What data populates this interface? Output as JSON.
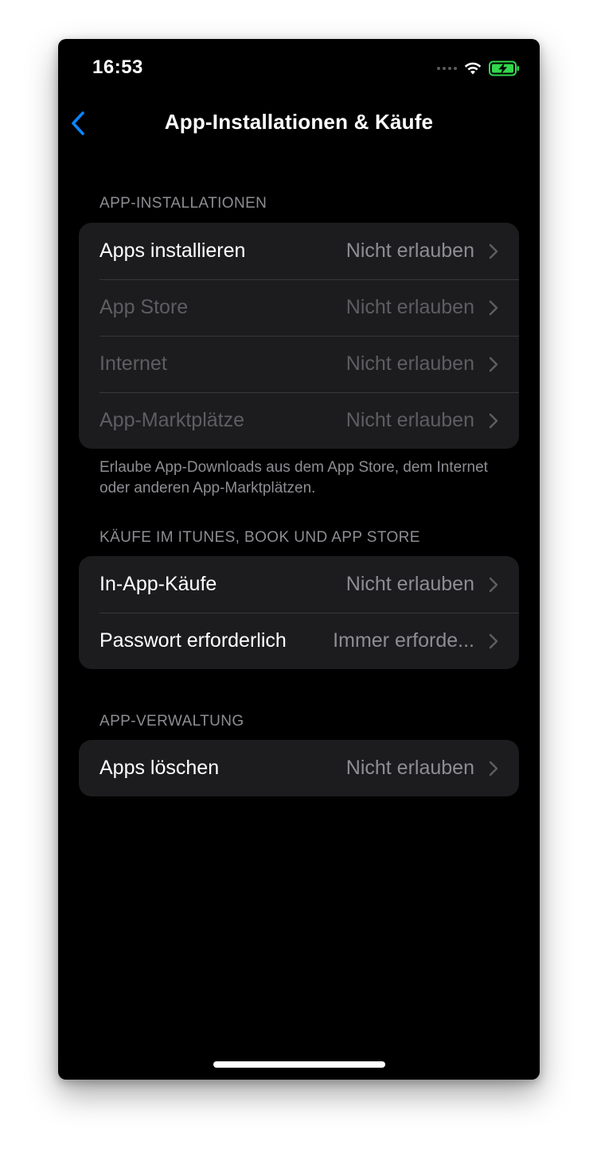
{
  "status_bar": {
    "time": "16:53"
  },
  "nav": {
    "title": "App-Installationen & Käufe"
  },
  "sections": {
    "installs": {
      "header": "APP-INSTALLATIONEN",
      "rows": [
        {
          "label": "Apps installieren",
          "value": "Nicht erlauben"
        },
        {
          "label": "App Store",
          "value": "Nicht erlauben"
        },
        {
          "label": "Internet",
          "value": "Nicht erlauben"
        },
        {
          "label": "App-Marktplätze",
          "value": "Nicht erlauben"
        }
      ],
      "footer": "Erlaube App-Downloads aus dem App Store, dem Internet oder anderen App-Marktplätzen."
    },
    "purchases": {
      "header": "KÄUFE IM ITUNES, BOOK UND APP STORE",
      "rows": [
        {
          "label": "In-App-Käufe",
          "value": "Nicht erlauben"
        },
        {
          "label": "Passwort erforderlich",
          "value": "Immer erforde..."
        }
      ]
    },
    "management": {
      "header": "APP-VERWALTUNG",
      "rows": [
        {
          "label": "Apps löschen",
          "value": "Nicht erlauben"
        }
      ]
    }
  },
  "colors": {
    "accent": "#0a84ff",
    "battery_charging": "#32d74b",
    "background": "#000000",
    "group_background": "#1c1c1e",
    "secondary_text": "#8d8d93",
    "disabled_text": "#5e5e62"
  },
  "icons": {
    "back": "chevron-left-icon",
    "row_disclosure": "chevron-right-icon",
    "wifi": "wifi-icon",
    "battery": "battery-charging-icon",
    "signal": "cellular-signal-icon"
  }
}
